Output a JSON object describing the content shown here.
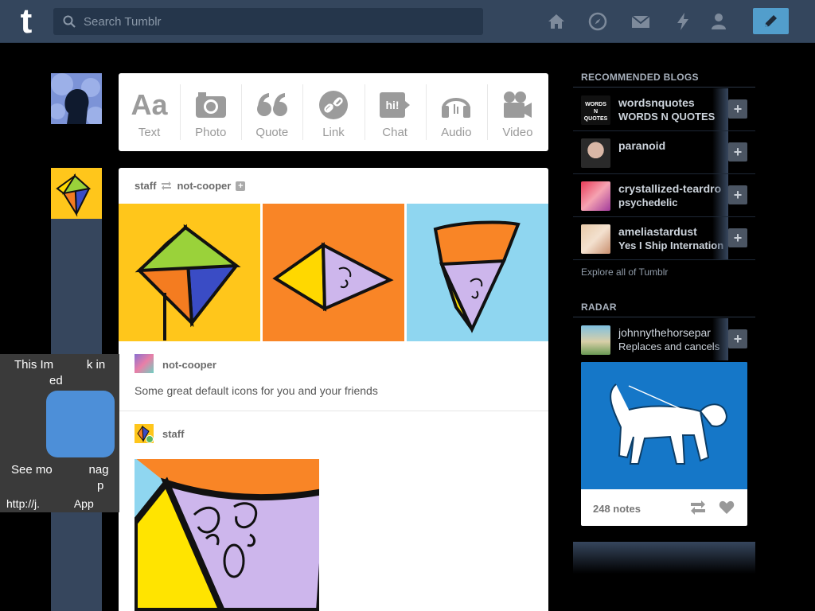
{
  "header": {
    "logo": "t",
    "search_placeholder": "Search Tumblr",
    "nav_icons": [
      "home-icon",
      "explore-icon",
      "inbox-icon",
      "activity-icon",
      "account-icon"
    ],
    "compose_icon": "pencil-icon"
  },
  "post_types": [
    {
      "icon": "Aa",
      "label": "Text"
    },
    {
      "icon": "camera",
      "label": "Photo"
    },
    {
      "icon": "“",
      "label": "Quote"
    },
    {
      "icon": "link",
      "label": "Link"
    },
    {
      "icon": "hi!",
      "label": "Chat"
    },
    {
      "icon": "headphones",
      "label": "Audio"
    },
    {
      "icon": "video",
      "label": "Video"
    }
  ],
  "post": {
    "author": "staff",
    "reblogged_from": "not-cooper",
    "trail": [
      {
        "name": "not-cooper",
        "text": "Some great default icons for you and your friends"
      },
      {
        "name": "staff"
      }
    ]
  },
  "popup": {
    "line1": "This Im",
    "line1b": "k in",
    "line2": "ed",
    "line3a": "See mo",
    "line3b": "nag",
    "line3c": "p",
    "line4a": "http://j.",
    "line4b": "App"
  },
  "sidebar": {
    "recommended_title": "RECOMMENDED BLOGS",
    "recommended": [
      {
        "name": "wordsnquotes",
        "subtitle": "WORDS N QUOTES",
        "avatar_text": "WORDS N QUOTES"
      },
      {
        "name": "paranoid",
        "subtitle": ""
      },
      {
        "name": "crystallized-teardro",
        "subtitle": "psychedelic"
      },
      {
        "name": "ameliastardust",
        "subtitle": "Yes I Ship Internation"
      }
    ],
    "explore_link": "Explore all of Tumblr",
    "radar_title": "RADAR",
    "radar": {
      "name": "johnnythehorsepar",
      "subtitle": "Replaces and cancels",
      "notes": "248 notes"
    }
  },
  "colors": {
    "header_bg": "#34465d",
    "compose_blue": "#529ecc",
    "page_bg": "#000000"
  }
}
